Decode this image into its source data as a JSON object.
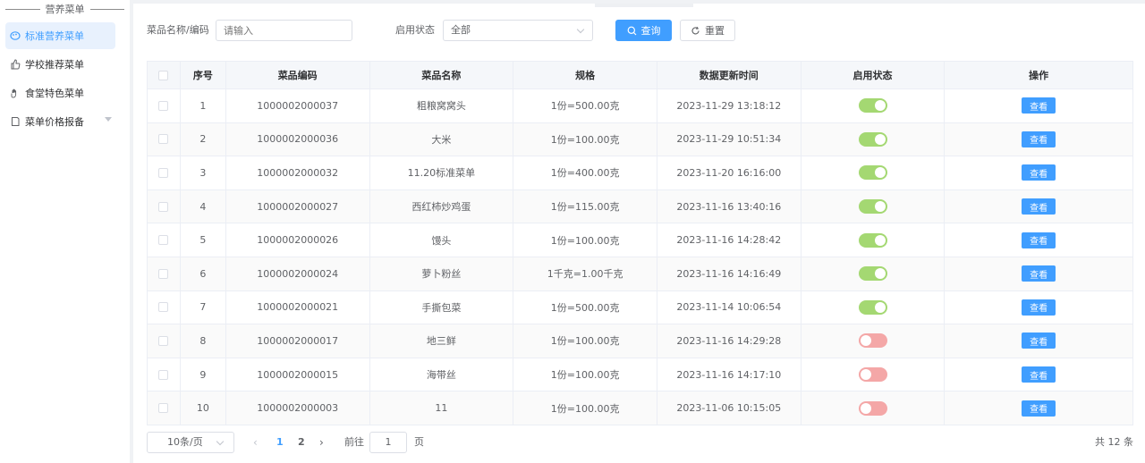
{
  "sidebar": {
    "title": "营养菜单",
    "items": [
      {
        "label": "标准营养菜单",
        "icon": "palette-icon",
        "active": true
      },
      {
        "label": "学校推荐菜单",
        "icon": "thumbs-up-icon",
        "active": false
      },
      {
        "label": "食堂特色菜单",
        "icon": "hand-icon",
        "active": false
      },
      {
        "label": "菜单价格报备",
        "icon": "document-icon",
        "active": false
      }
    ]
  },
  "filters": {
    "name_label": "菜品名称/编码",
    "name_placeholder": "请输入",
    "status_label": "启用状态",
    "status_value": "全部",
    "search_label": "查询",
    "reset_label": "重置"
  },
  "table": {
    "headers": [
      "序号",
      "菜品编码",
      "菜品名称",
      "规格",
      "数据更新时间",
      "启用状态",
      "操作"
    ],
    "action_label": "查看",
    "rows": [
      {
        "no": "1",
        "code": "1000002000037",
        "name": "粗粮窝窝头",
        "spec": "1份=500.00克",
        "updated": "2023-11-29 13:18:12",
        "enabled": true
      },
      {
        "no": "2",
        "code": "1000002000036",
        "name": "大米",
        "spec": "1份=100.00克",
        "updated": "2023-11-29 10:51:34",
        "enabled": true
      },
      {
        "no": "3",
        "code": "1000002000032",
        "name": "11.20标准菜单",
        "spec": "1份=400.00克",
        "updated": "2023-11-20 16:16:00",
        "enabled": true
      },
      {
        "no": "4",
        "code": "1000002000027",
        "name": "西红柿炒鸡蛋",
        "spec": "1份=115.00克",
        "updated": "2023-11-16 13:40:16",
        "enabled": true
      },
      {
        "no": "5",
        "code": "1000002000026",
        "name": "馒头",
        "spec": "1份=100.00克",
        "updated": "2023-11-16 14:28:42",
        "enabled": true
      },
      {
        "no": "6",
        "code": "1000002000024",
        "name": "萝卜粉丝",
        "spec": "1千克=1.00千克",
        "updated": "2023-11-16 14:16:49",
        "enabled": true
      },
      {
        "no": "7",
        "code": "1000002000021",
        "name": "手撕包菜",
        "spec": "1份=500.00克",
        "updated": "2023-11-14 10:06:54",
        "enabled": true
      },
      {
        "no": "8",
        "code": "1000002000017",
        "name": "地三鲜",
        "spec": "1份=100.00克",
        "updated": "2023-11-16 14:29:28",
        "enabled": false
      },
      {
        "no": "9",
        "code": "1000002000015",
        "name": "海带丝",
        "spec": "1份=100.00克",
        "updated": "2023-11-16 14:17:10",
        "enabled": false
      },
      {
        "no": "10",
        "code": "1000002000003",
        "name": "11",
        "spec": "1份=100.00克",
        "updated": "2023-11-06 10:15:05",
        "enabled": false
      }
    ]
  },
  "pagination": {
    "page_size": "10条/页",
    "pages": [
      "1",
      "2"
    ],
    "current_page": "1",
    "goto_label": "前往",
    "goto_value": "1",
    "page_unit": "页",
    "total": "共 12 条"
  }
}
